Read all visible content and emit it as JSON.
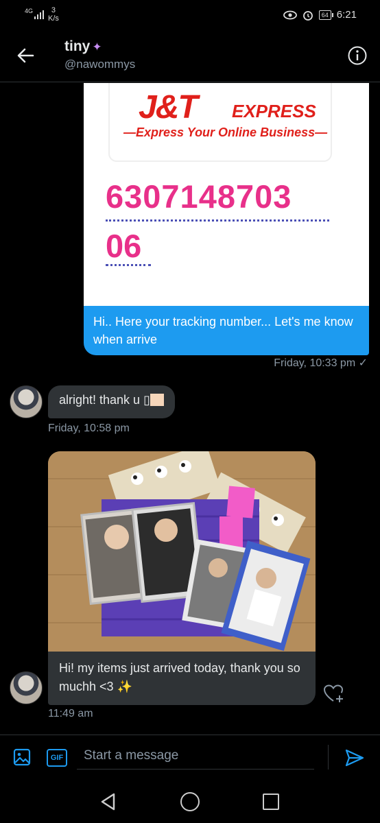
{
  "status_bar": {
    "network": "4G",
    "speed_value": "3",
    "speed_unit": "K/s",
    "battery": "64",
    "time": "6:21"
  },
  "header": {
    "name": "tiny",
    "handle": "@nawommys"
  },
  "messages": {
    "sent_image": {
      "logo_text": "J&T",
      "express_text": "EXPRESS",
      "tagline": "—Express Your Online Business—",
      "tracking_line1": "6307148703",
      "tracking_line2": "06"
    },
    "sent_text": "Hi.. Here your tracking number... Let's me know when arrive",
    "sent_time": "Friday, 10:33 pm ✓",
    "recv1_text": "alright! thank u",
    "recv1_glyph": "▯",
    "recv1_time": "Friday, 10:58 pm",
    "recv2_text": "Hi! my items just arrived today, thank you so muchh <3",
    "recv2_emoji": "✨",
    "recv2_time": "11:49 am"
  },
  "composer": {
    "gif_label": "GIF",
    "placeholder": "Start a message"
  },
  "colors": {
    "accent": "#1d9bf0",
    "background": "#000000",
    "bubble_received": "#2f3336",
    "jt_red": "#e0201b",
    "tracking_pink": "#e8308a"
  }
}
